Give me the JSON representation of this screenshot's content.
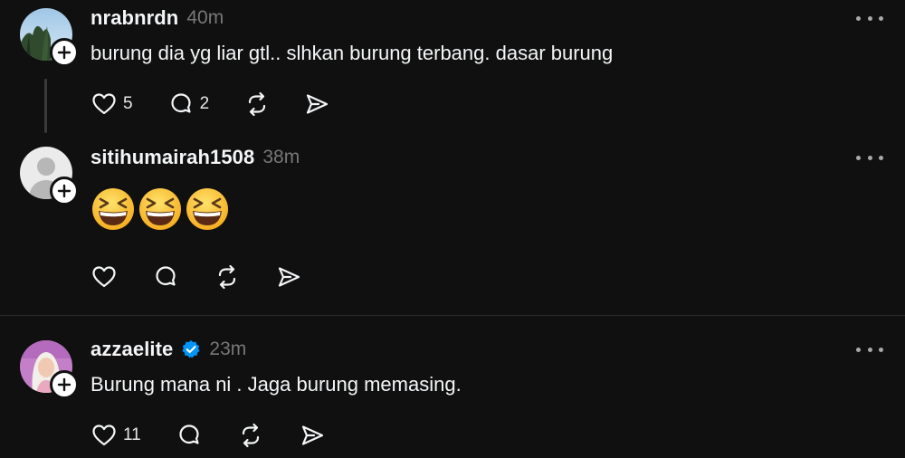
{
  "posts": [
    {
      "username": "nrabnrdn",
      "time": "40m",
      "text": "burung dia yg liar gtl.. slhkan burung terbang. dasar burung",
      "likes": "5",
      "replies": "2",
      "verified": false,
      "avatar": "sky-trees-photo"
    },
    {
      "username": "sitihumairah1508",
      "time": "38m",
      "emojis": [
        "😆",
        "😆",
        "😆"
      ],
      "likes": "",
      "replies": "",
      "verified": false,
      "avatar": "default-person"
    },
    {
      "username": "azzaelite",
      "time": "23m",
      "text": "Burung mana ni . Jaga burung memasing.",
      "likes": "11",
      "replies": "",
      "verified": true,
      "avatar": "woman-photo"
    }
  ],
  "colors": {
    "background": "#101010",
    "text": "#f3f5f7",
    "muted": "#777777",
    "verified": "#0095f6"
  },
  "icons": [
    "heart-icon",
    "comment-icon",
    "repost-icon",
    "share-icon",
    "more-icon",
    "plus-icon",
    "verified-badge-icon"
  ]
}
